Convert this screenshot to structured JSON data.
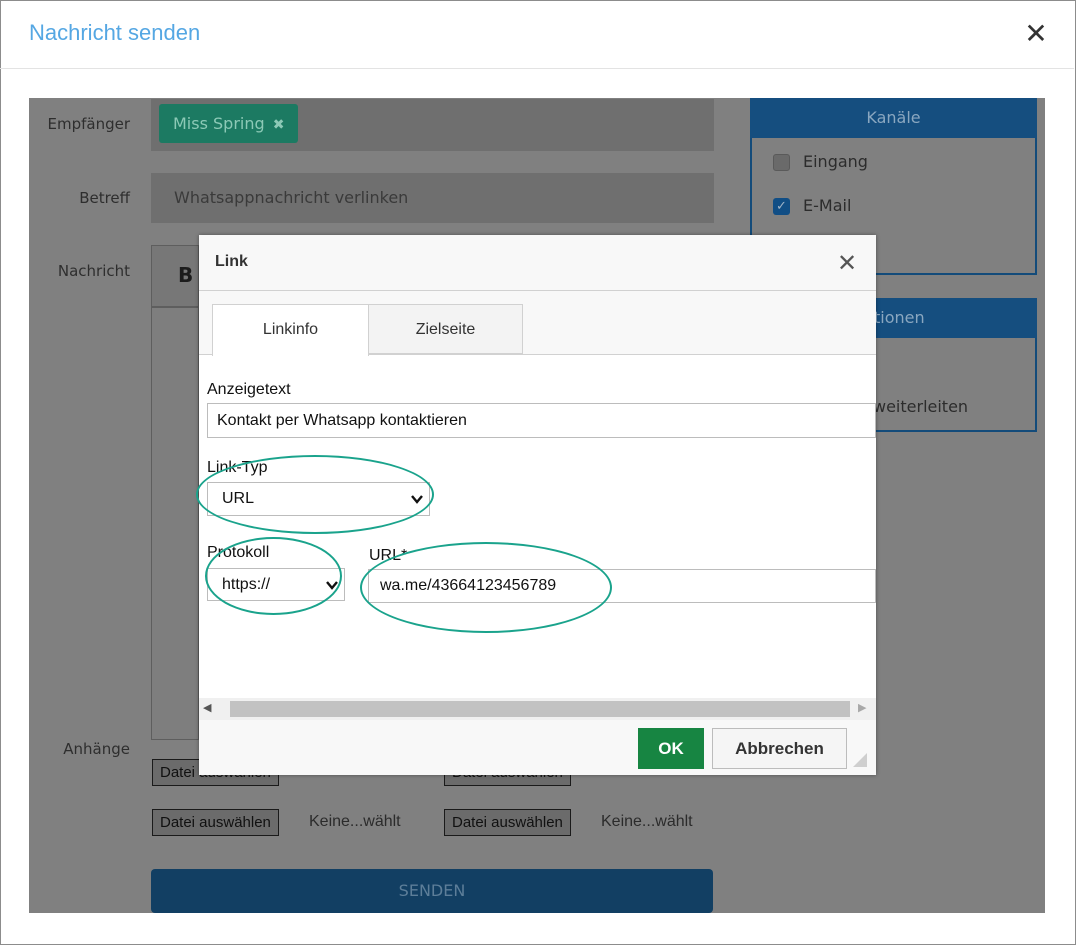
{
  "modal": {
    "title": "Nachricht senden",
    "close_glyph": "✕"
  },
  "form": {
    "recipient_label": "Empfänger",
    "recipient_tag": "Miss Spring",
    "recipient_remove_glyph": "✖",
    "subject_label": "Betreff",
    "subject_value": "Whatsappnachricht verlinken",
    "message_label": "Nachricht",
    "bold_button": "B",
    "attachments_label": "Anhänge",
    "file_button": "Datei auswählen",
    "file_status": "Keine...wählt",
    "file_status_obscured": "Keine...wählt",
    "send_button": "SENDEN"
  },
  "channels": {
    "header": "Kanäle",
    "inbox_label": "Eingang",
    "email_label": "E-Mail",
    "email_checked": true
  },
  "options": {
    "header_partial": "tionen",
    "forward_partial": "weiterleiten"
  },
  "link_dialog": {
    "title": "Link",
    "close_glyph": "✕",
    "tabs": [
      {
        "label": "Linkinfo",
        "active": true
      },
      {
        "label": "Zielseite",
        "active": false
      }
    ],
    "display_text_label": "Anzeigetext",
    "display_text_value": "Kontakt per Whatsapp kontaktieren",
    "link_type_label": "Link-Typ",
    "link_type_value": "URL",
    "protocol_label": "Protokoll",
    "protocol_value": "https://",
    "url_label": "URL*",
    "url_value": "wa.me/43664123456789",
    "ok_button": "OK",
    "cancel_button": "Abbrechen"
  },
  "icons": {
    "close": "close-icon",
    "chevron": "chevron-down-icon",
    "resize": "resize-grip-icon"
  },
  "colors": {
    "title_blue": "#55a7e3",
    "ok_green": "#178542",
    "annotation_teal": "#1aa38c",
    "panel_blue": "#154e7f"
  }
}
